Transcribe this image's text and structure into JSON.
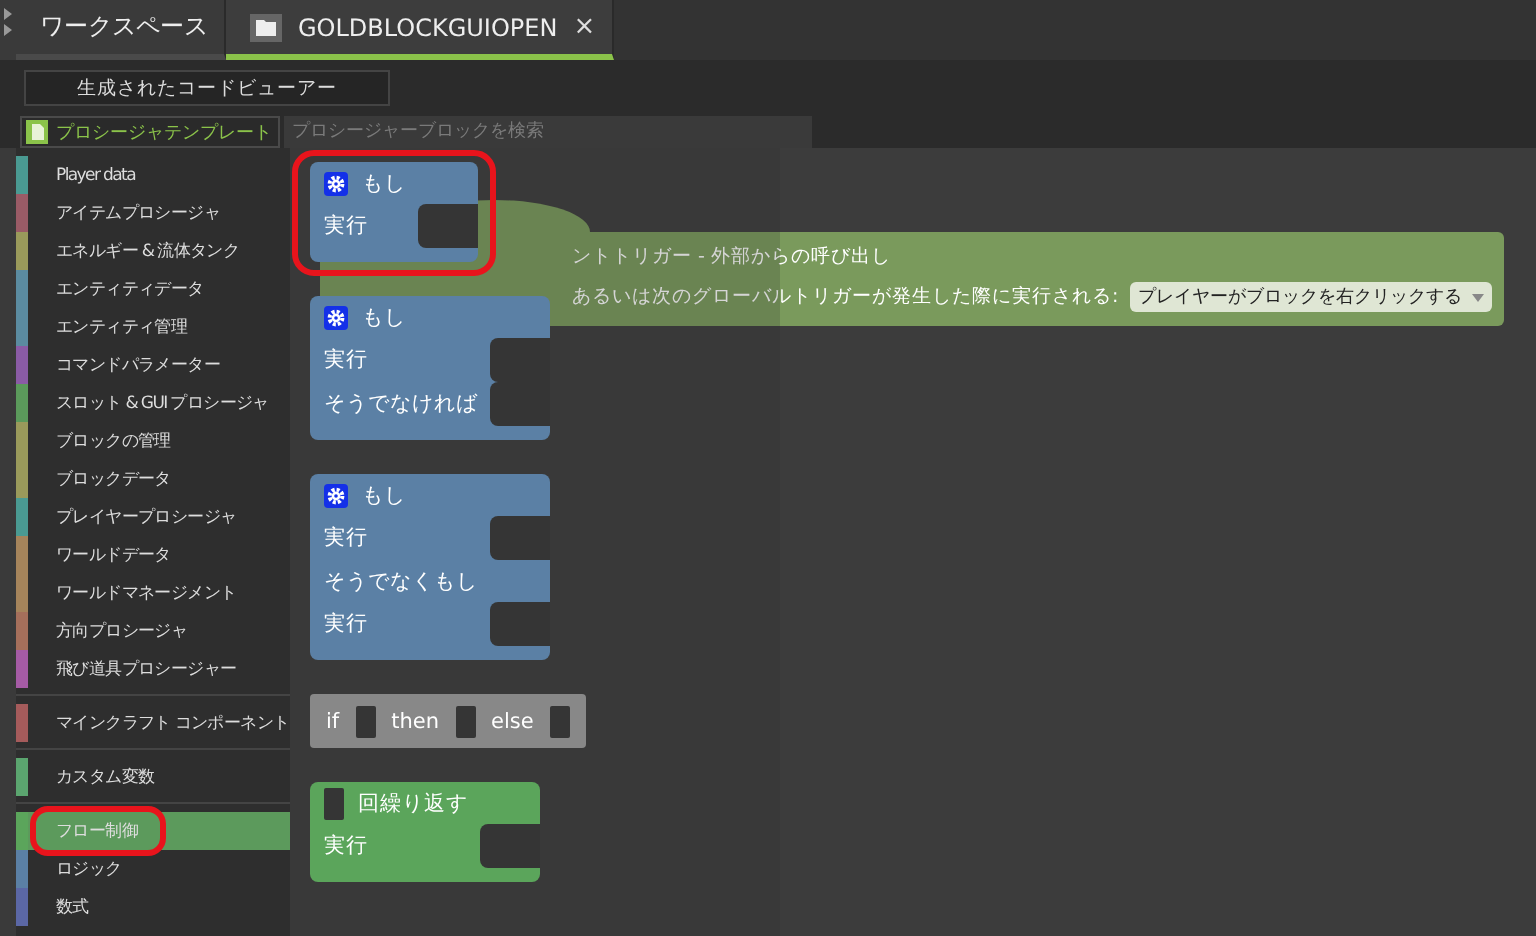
{
  "tabs": [
    {
      "label": "ワークスペース",
      "selected": false,
      "kind": "text"
    },
    {
      "label": "GOLDBLOCKGUIOPEN",
      "selected": true,
      "kind": "file",
      "close": "×"
    }
  ],
  "code_viewer_button": "生成されたコードビューアー",
  "palette": {
    "title": "プロシージャテンプレート",
    "search": {
      "placeholder": "プロシージャーブロックを検索"
    }
  },
  "category_groups": [
    [
      {
        "label": "Player data",
        "color": "#4a9a92",
        "selected": false,
        "highlighted": false
      },
      {
        "label": "アイテムプロシージャ",
        "color": "#9a5b66",
        "selected": false,
        "highlighted": false
      },
      {
        "label": "エネルギー & 流体タンク",
        "color": "#9a9a5b",
        "selected": false,
        "highlighted": false
      },
      {
        "label": "エンティティデータ",
        "color": "#5b8ba0",
        "selected": false,
        "highlighted": false
      },
      {
        "label": "エンティティ管理",
        "color": "#5b8ba0",
        "selected": false,
        "highlighted": false
      },
      {
        "label": "コマンドパラメーター",
        "color": "#8a5ba5",
        "selected": false,
        "highlighted": false
      },
      {
        "label": "スロット & GUI プロシージャ",
        "color": "#5b9a5b",
        "selected": false,
        "highlighted": false
      },
      {
        "label": "ブロックの管理",
        "color": "#9a9a5b",
        "selected": false,
        "highlighted": false
      },
      {
        "label": "ブロックデータ",
        "color": "#9a9a5b",
        "selected": false,
        "highlighted": false
      },
      {
        "label": "プレイヤープロシージャ",
        "color": "#4a9a92",
        "selected": false,
        "highlighted": false
      },
      {
        "label": "ワールドデータ",
        "color": "#a5845b",
        "selected": false,
        "highlighted": false
      },
      {
        "label": "ワールドマネージメント",
        "color": "#a5845b",
        "selected": false,
        "highlighted": false
      },
      {
        "label": "方向プロシージャ",
        "color": "#a56f5b",
        "selected": false,
        "highlighted": false
      },
      {
        "label": "飛び道具プロシージャー",
        "color": "#a55ba5",
        "selected": false,
        "highlighted": false
      }
    ],
    [
      {
        "label": "マインクラフト コンポーネント",
        "color": "#a55b5b",
        "selected": false,
        "highlighted": false
      }
    ],
    [
      {
        "label": "カスタム変数",
        "color": "#5ba56f",
        "selected": false,
        "highlighted": false
      }
    ],
    [
      {
        "label": "フロー制御",
        "color": "#5ba55b",
        "selected": true,
        "highlighted": true
      },
      {
        "label": "ロジック",
        "color": "#5b80a5",
        "selected": false,
        "highlighted": false
      },
      {
        "label": "数式",
        "color": "#5b67a5",
        "selected": false,
        "highlighted": false
      }
    ]
  ],
  "flyout_blocks": [
    {
      "kind": "stack",
      "color": "#5b80a5",
      "highlighted": true,
      "rows": [
        {
          "kind": "if_header",
          "label": "もし"
        },
        {
          "kind": "statement",
          "label": "実行"
        }
      ]
    },
    {
      "kind": "stack",
      "color": "#5b80a5",
      "highlighted": false,
      "rows": [
        {
          "kind": "if_header",
          "label": "もし"
        },
        {
          "kind": "statement",
          "label": "実行"
        },
        {
          "kind": "statement",
          "label": "そうでなければ"
        }
      ]
    },
    {
      "kind": "stack",
      "color": "#5b80a5",
      "highlighted": false,
      "rows": [
        {
          "kind": "if_header",
          "label": "もし"
        },
        {
          "kind": "statement",
          "label": "実行"
        },
        {
          "kind": "header",
          "label": "そうでなくもし"
        },
        {
          "kind": "statement",
          "label": "実行"
        }
      ]
    },
    {
      "kind": "inline",
      "color": "#888888",
      "highlighted": false,
      "parts": [
        {
          "kind": "label",
          "text": "if"
        },
        {
          "kind": "socket"
        },
        {
          "kind": "label",
          "text": "then"
        },
        {
          "kind": "socket"
        },
        {
          "kind": "label",
          "text": "else"
        },
        {
          "kind": "socket"
        }
      ]
    },
    {
      "kind": "stack",
      "color": "#5ba55b",
      "highlighted": false,
      "rows": [
        {
          "kind": "count_header",
          "label": "回繰り返す"
        },
        {
          "kind": "statement",
          "label": "実行"
        }
      ]
    }
  ],
  "event_block": {
    "line_1": "ントトリガー - 外部からの呼び出し",
    "line_2": "あるいは次のグローバルトリガーが発生した際に実行される:",
    "dropdown": "プレイヤーがブロックを右クリックする"
  }
}
